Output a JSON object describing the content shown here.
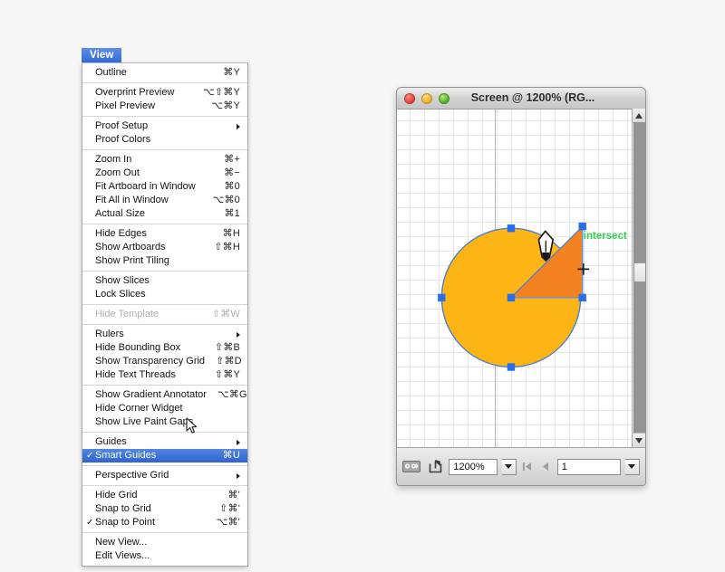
{
  "menu": {
    "title": "View",
    "groups": [
      [
        {
          "label": "Outline",
          "shortcut": "⌘Y"
        }
      ],
      [
        {
          "label": "Overprint Preview",
          "shortcut": "⌥⇧⌘Y"
        },
        {
          "label": "Pixel Preview",
          "shortcut": "⌥⌘Y"
        }
      ],
      [
        {
          "label": "Proof Setup",
          "shortcut": "",
          "submenu": true
        },
        {
          "label": "Proof Colors",
          "shortcut": ""
        }
      ],
      [
        {
          "label": "Zoom In",
          "shortcut": "⌘+"
        },
        {
          "label": "Zoom Out",
          "shortcut": "⌘−"
        },
        {
          "label": "Fit Artboard in Window",
          "shortcut": "⌘0"
        },
        {
          "label": "Fit All in Window",
          "shortcut": "⌥⌘0"
        },
        {
          "label": "Actual Size",
          "shortcut": "⌘1"
        }
      ],
      [
        {
          "label": "Hide Edges",
          "shortcut": "⌘H"
        },
        {
          "label": "Show Artboards",
          "shortcut": "⇧⌘H"
        },
        {
          "label": "Show Print Tiling",
          "shortcut": ""
        }
      ],
      [
        {
          "label": "Show Slices",
          "shortcut": ""
        },
        {
          "label": "Lock Slices",
          "shortcut": ""
        }
      ],
      [
        {
          "label": "Hide Template",
          "shortcut": "⇧⌘W",
          "disabled": true
        }
      ],
      [
        {
          "label": "Rulers",
          "shortcut": "",
          "submenu": true
        },
        {
          "label": "Hide Bounding Box",
          "shortcut": "⇧⌘B"
        },
        {
          "label": "Show Transparency Grid",
          "shortcut": "⇧⌘D"
        },
        {
          "label": "Hide Text Threads",
          "shortcut": "⇧⌘Y"
        }
      ],
      [
        {
          "label": "Show Gradient Annotator",
          "shortcut": "⌥⌘G"
        },
        {
          "label": "Hide Corner Widget",
          "shortcut": ""
        },
        {
          "label": "Show Live Paint Gaps",
          "shortcut": ""
        }
      ],
      [
        {
          "label": "Guides",
          "shortcut": "",
          "submenu": true
        },
        {
          "label": "Smart Guides",
          "shortcut": "⌘U",
          "checked": true,
          "selected": true
        }
      ],
      [
        {
          "label": "Perspective Grid",
          "shortcut": "",
          "submenu": true
        }
      ],
      [
        {
          "label": "Hide Grid",
          "shortcut": "⌘'"
        },
        {
          "label": "Snap to Grid",
          "shortcut": "⇧⌘'"
        },
        {
          "label": "Snap to Point",
          "shortcut": "⌥⌘'",
          "checked": true
        }
      ],
      [
        {
          "label": "New View...",
          "shortcut": ""
        },
        {
          "label": "Edit Views...",
          "shortcut": ""
        }
      ]
    ]
  },
  "document_window": {
    "title": "Screen @ 1200% (RG...",
    "traffic_lights": {
      "close": "close-button",
      "minimize": "minimize-button",
      "zoom": "zoom-button"
    },
    "canvas": {
      "smart_guide_label": "intersect",
      "smart_guide_color": "#2fd34a",
      "circle_fill": "#fdb515",
      "wedge_fill": "#f58220",
      "path_stroke": "#4a7fd4",
      "anchor_color": "#2a6ef0"
    },
    "status_bar": {
      "artboard_tool_icon": "artboard-options-icon",
      "share_icon": "share-export-icon",
      "zoom_value": "1200%",
      "zoom_dropdown_icon": "chevron-down-icon",
      "first_page_icon": "first-artboard-icon",
      "prev_page_icon": "previous-artboard-icon",
      "page_value": "1",
      "page_dropdown_icon": "chevron-down-icon"
    },
    "scrollbar": {
      "up_icon": "scroll-up-arrow",
      "down_icon": "scroll-down-arrow",
      "thumb": "scroll-thumb"
    }
  }
}
